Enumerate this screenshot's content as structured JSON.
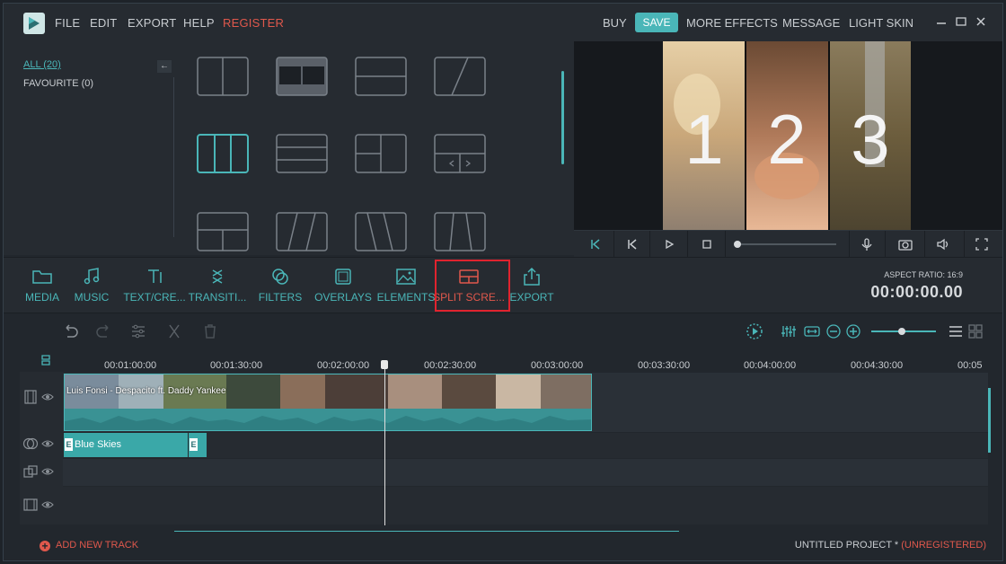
{
  "menu": {
    "file": "FILE",
    "edit": "EDIT",
    "export": "EXPORT",
    "help": "HELP",
    "register": "REGISTER"
  },
  "topright": {
    "buy": "BUY",
    "save": "SAVE",
    "more_effects": "MORE EFFECTS",
    "message": "MESSAGE",
    "light_skin": "LIGHT SKIN"
  },
  "categories": {
    "all": "ALL (20)",
    "favourite": "FAVOURITE (0)"
  },
  "preview": {
    "numbers": [
      "1",
      "2",
      "3"
    ]
  },
  "toolbar": {
    "tools": [
      {
        "label": "MEDIA",
        "icon": "folder-icon"
      },
      {
        "label": "MUSIC",
        "icon": "music-note-icon"
      },
      {
        "label": "TEXT/CRE...",
        "icon": "text-icon"
      },
      {
        "label": "TRANSITI...",
        "icon": "transition-icon"
      },
      {
        "label": "FILTERS",
        "icon": "filters-icon"
      },
      {
        "label": "OVERLAYS",
        "icon": "overlays-icon"
      },
      {
        "label": "ELEMENTS",
        "icon": "image-icon"
      },
      {
        "label": "SPLIT SCRE...",
        "icon": "split-screen-icon"
      },
      {
        "label": "EXPORT",
        "icon": "share-icon"
      }
    ],
    "aspect_ratio": "ASPECT RATIO: 16:9",
    "timecode": "00:00:00.00"
  },
  "ruler": [
    "00:01:00:00",
    "00:01:30:00",
    "00:02:00:00",
    "00:02:30:00",
    "00:03:00:00",
    "00:03:30:00",
    "00:04:00:00",
    "00:04:30:00",
    "00:05"
  ],
  "tracks": {
    "video_clip": "Luis Fonsi - Despacito ft. Daddy Yankee",
    "title_clip": "Blue Skies",
    "title_badge": "E"
  },
  "status": {
    "add_track": "ADD NEW TRACK",
    "project": "UNTITLED PROJECT *",
    "unregistered": "(UNREGISTERED)"
  },
  "colors": {
    "accent": "#4ab6b8",
    "warning": "#e0584c",
    "highlight": "#e0232e"
  }
}
